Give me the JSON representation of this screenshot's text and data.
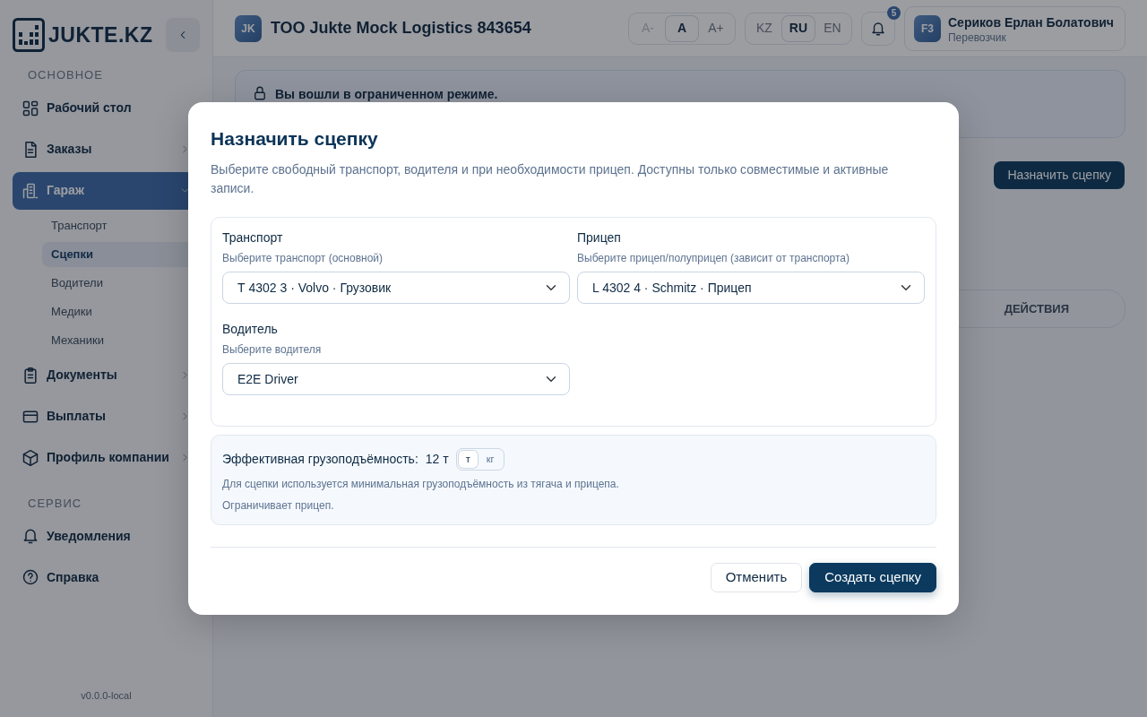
{
  "sidebar": {
    "logo": "JUKTE.KZ",
    "sections": [
      {
        "title": "ОСНОВНОЕ",
        "items": [
          {
            "label": "Рабочий стол",
            "expandable": false,
            "selected": false
          },
          {
            "label": "Заказы",
            "expandable": true,
            "expanded": false,
            "selected": false
          },
          {
            "label": "Гараж",
            "expandable": true,
            "expanded": true,
            "selected": true,
            "children": [
              {
                "label": "Транспорт",
                "selected": false
              },
              {
                "label": "Сцепки",
                "selected": true
              },
              {
                "label": "Водители",
                "selected": false
              },
              {
                "label": "Медики",
                "selected": false
              },
              {
                "label": "Механики",
                "selected": false
              }
            ]
          },
          {
            "label": "Документы",
            "expandable": true,
            "expanded": false,
            "selected": false
          },
          {
            "label": "Выплаты",
            "expandable": true,
            "expanded": false,
            "selected": false
          },
          {
            "label": "Профиль компании",
            "expandable": true,
            "expanded": false,
            "selected": false
          }
        ]
      },
      {
        "title": "СЕРВИС",
        "items": [
          {
            "label": "Уведомления",
            "expandable": false,
            "selected": false
          },
          {
            "label": "Справка",
            "expandable": false,
            "selected": false
          }
        ]
      }
    ],
    "version": "v0.0.0-local"
  },
  "header": {
    "company_badge": "JK",
    "company": "ТОО Jukte Mock Logistics 843654",
    "font_sizes": [
      {
        "label": "A-",
        "selected": false,
        "disabled": true
      },
      {
        "label": "A",
        "selected": true,
        "disabled": false
      },
      {
        "label": "A+",
        "selected": false,
        "disabled": false
      }
    ],
    "languages": [
      {
        "label": "KZ",
        "selected": false
      },
      {
        "label": "RU",
        "selected": true
      },
      {
        "label": "EN",
        "selected": false
      }
    ],
    "notifications_count": "5",
    "user": {
      "avatar": "F3",
      "name": "Сериков Ерлан Болатович",
      "role": "Перевозчик"
    }
  },
  "alert": "Вы вошли в ограниченном режиме.",
  "assign_button": "Назначить сцепку",
  "table": {
    "columns": [
      "ДЕЙСТВИЯ"
    ]
  },
  "modal": {
    "title": "Назначить сцепку",
    "description": "Выберите свободный транспорт, водителя и при необходимости прицеп. Доступны только совместимые и активные записи.",
    "fields": [
      {
        "label": "Транспорт",
        "hint": "Выберите транспорт (основной)",
        "value": "Т 4302 3 · Volvo · Грузовик"
      },
      {
        "label": "Прицеп",
        "hint": "Выберите прицеп/полуприцеп (зависит от транспорта)",
        "value": "L 4302 4 · Schmitz · Прицеп"
      },
      {
        "label": "Водитель",
        "hint": "Выберите водителя",
        "value": "E2E Driver"
      }
    ],
    "capacity": {
      "label": "Эффективная грузоподъёмность:",
      "value": "12 т",
      "units": [
        {
          "label": "т",
          "selected": true
        },
        {
          "label": "кг",
          "selected": false
        }
      ],
      "notes": [
        "Для сцепки используется минимальная грузоподъёмность из тягача и прицепа.",
        "Ограничивает прицеп."
      ]
    },
    "buttons": [
      {
        "label": "Отменить",
        "kind": "secondary"
      },
      {
        "label": "Создать сцепку",
        "kind": "primary"
      }
    ]
  }
}
